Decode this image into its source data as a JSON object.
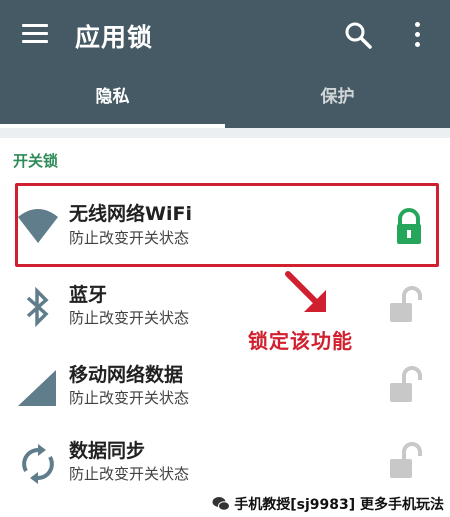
{
  "appbar": {
    "title": "应用锁",
    "tabs": [
      {
        "label": "隐私",
        "selected": true
      },
      {
        "label": "保护",
        "selected": false
      }
    ],
    "background_color": "#455a64"
  },
  "section": {
    "header": "开关锁",
    "header_color": "#2e8b57"
  },
  "items": [
    {
      "title": "无线网络WiFi",
      "subtitle": "防止改变开关状态",
      "icon": "wifi-icon",
      "locked": true
    },
    {
      "title": "蓝牙",
      "subtitle": "防止改变开关状态",
      "icon": "bluetooth-icon",
      "locked": false
    },
    {
      "title": "移动网络数据",
      "subtitle": "防止改变开关状态",
      "icon": "cellular-signal-icon",
      "locked": false
    },
    {
      "title": "数据同步",
      "subtitle": "防止改变开关状态",
      "icon": "sync-icon",
      "locked": false
    }
  ],
  "annotation": {
    "text": "锁定该功能",
    "color": "#d0202f"
  },
  "watermark": {
    "text": "手机教授[sj9983] 更多手机玩法"
  },
  "colors": {
    "locked": "#26a65b",
    "unlocked": "#c8c8c8",
    "icon": "#607d8b"
  }
}
